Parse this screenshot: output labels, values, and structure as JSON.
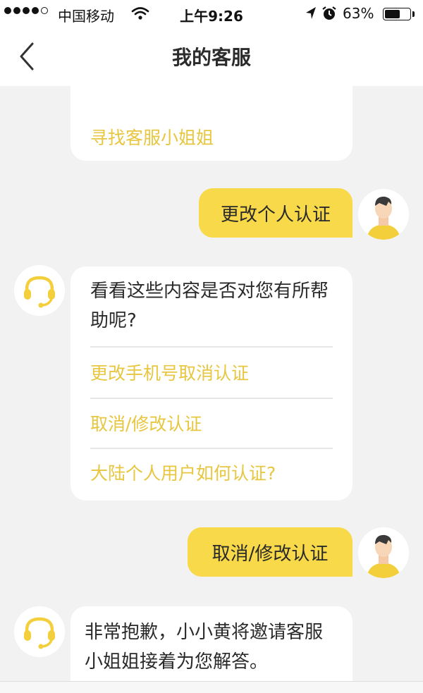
{
  "status_bar": {
    "carrier": "中国移动",
    "time": "上午9:26",
    "battery_percent": "63%",
    "battery_level": 0.63,
    "icons": [
      "signal-dots-icon",
      "wifi-icon",
      "location-arrow-icon",
      "alarm-clock-icon",
      "battery-icon"
    ]
  },
  "nav": {
    "title": "我的客服",
    "back_icon": "chevron-left-icon"
  },
  "messages": [
    {
      "from": "bot",
      "options": [
        "寻找客服小姐姐"
      ]
    },
    {
      "from": "user",
      "text": "更改个人认证"
    },
    {
      "from": "bot",
      "text": "看看这些内容是否对您有所帮助呢?",
      "options": [
        "更改手机号取消认证",
        "取消/修改认证",
        "大陆个人用户如何认证?"
      ]
    },
    {
      "from": "user",
      "text": "取消/修改认证"
    },
    {
      "from": "bot",
      "text": "非常抱歉，小小黄将邀请客服小姐姐接着为您解答。"
    }
  ],
  "colors": {
    "accent": "#f7d94a",
    "link": "#e7c640",
    "background": "#f2f2f2",
    "bubble": "#ffffff"
  }
}
